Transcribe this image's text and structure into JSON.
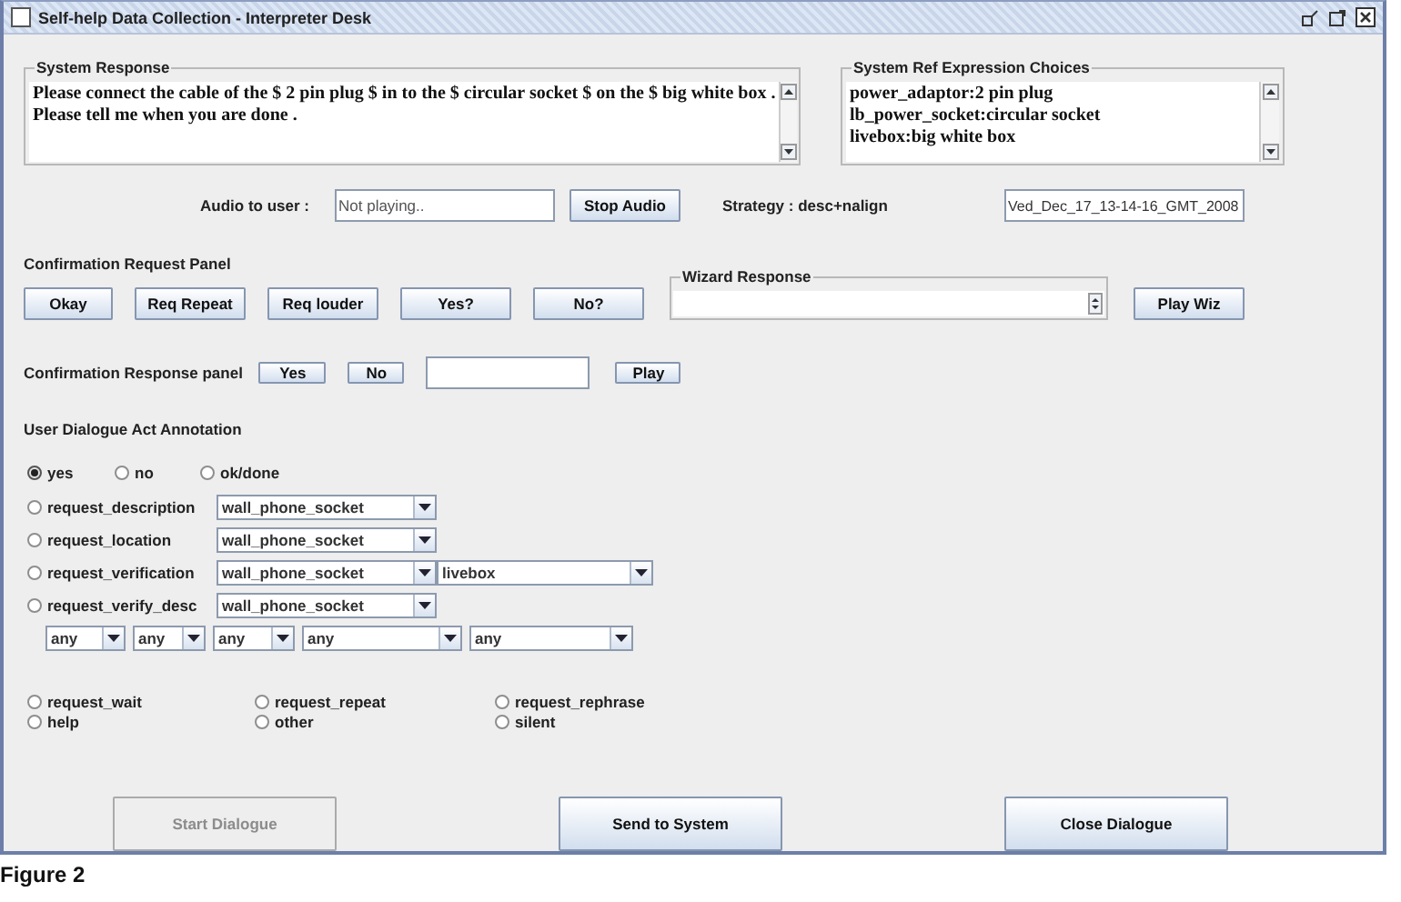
{
  "window": {
    "title": "Self-help Data Collection - Interpreter Desk"
  },
  "system_response": {
    "title": "System Response",
    "lines": [
      "Please connect the cable of the $ 2 pin plug $ in to the $ circular socket $ on the $ big white box .",
      "Please tell me when you are done ."
    ]
  },
  "ref_choices": {
    "title": "System Ref Expression Choices",
    "lines": [
      "power_adaptor:2 pin plug",
      "lb_power_socket:circular socket",
      "livebox:big white box"
    ]
  },
  "audio": {
    "label": "Audio to user :",
    "value": "Not playing..",
    "button": "Stop Audio"
  },
  "strategy": {
    "label": "Strategy : desc+nalign",
    "value": "Ved_Dec_17_13-14-16_GMT_2008"
  },
  "confirmation_request": {
    "title": "Confirmation Request Panel",
    "buttons": [
      "Okay",
      "Req Repeat",
      "Req louder",
      "Yes?",
      "No?"
    ],
    "wizard_title": "Wizard Response",
    "play_button": "Play Wiz"
  },
  "confirmation_response": {
    "label": "Confirmation Response panel",
    "buttons": [
      "Yes",
      "No"
    ],
    "play_button": "Play"
  },
  "annotation": {
    "title": "User Dialogue Act Annotation",
    "answers": [
      {
        "label": "yes",
        "selected": true
      },
      {
        "label": "no",
        "selected": false
      },
      {
        "label": "ok/done",
        "selected": false
      }
    ],
    "requests": [
      {
        "label": "request_description",
        "selected": false,
        "combos": [
          "wall_phone_socket"
        ]
      },
      {
        "label": "request_location",
        "selected": false,
        "combos": [
          "wall_phone_socket"
        ]
      },
      {
        "label": "request_verification",
        "selected": false,
        "combos": [
          "wall_phone_socket",
          "livebox"
        ]
      },
      {
        "label": "request_verify_desc",
        "selected": false,
        "combos": [
          "wall_phone_socket"
        ]
      }
    ],
    "filters": [
      "any",
      "any",
      "any",
      "any",
      "any"
    ],
    "other_acts": [
      {
        "label": "request_wait",
        "selected": false
      },
      {
        "label": "request_repeat",
        "selected": false
      },
      {
        "label": "request_rephrase",
        "selected": false
      },
      {
        "label": "help",
        "selected": false
      },
      {
        "label": "other",
        "selected": false
      },
      {
        "label": "silent",
        "selected": false
      }
    ]
  },
  "bottom_buttons": [
    {
      "label": "Start Dialogue",
      "disabled": true
    },
    {
      "label": "Send to System",
      "disabled": false
    },
    {
      "label": "Close Dialogue",
      "disabled": false
    }
  ],
  "caption": "Figure 2"
}
